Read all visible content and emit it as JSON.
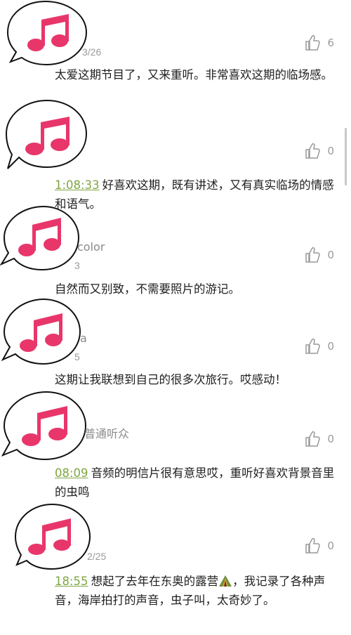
{
  "comments": [
    {
      "date": "3/26",
      "likes": "6",
      "timestamp": "",
      "text": "太爱这期节目了，又来重听。非常喜欢这期的临场感。",
      "name": ""
    },
    {
      "date": "",
      "likes": "0",
      "timestamp": "1:08:33",
      "text": "好喜欢这期，既有讲述，又有真实临场的情感和语气。",
      "name": ""
    },
    {
      "date": "3",
      "likes": "0",
      "timestamp": "",
      "text": "自然而又别致，不需要照片的游记。",
      "name": "color"
    },
    {
      "date": "5",
      "likes": "0",
      "timestamp": "",
      "text": "这期让我联想到自己的很多次旅行。哎感动！",
      "name": "a"
    },
    {
      "date": "",
      "likes": "0",
      "timestamp": "08:09",
      "text": "音频的明信片很有意思哎，重听好喜欢背景音里的虫鸣",
      "name": "普通听众"
    },
    {
      "date": "2/25",
      "likes": "0",
      "timestamp": "18:55",
      "text_before": "想起了去年在东奥的露营",
      "text_after": "，我记录了各种声音，海岸拍打的声音，虫子叫，太奇妙了。",
      "name": "",
      "emoji": "camping-tent-icon"
    }
  ],
  "colors": {
    "accent": "#e8366b",
    "timestamp": "#7fa642"
  }
}
